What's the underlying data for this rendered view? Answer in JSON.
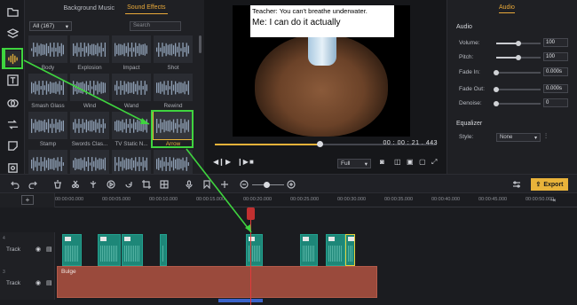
{
  "library": {
    "tabs": [
      {
        "label": "Background Music"
      },
      {
        "label": "Sound Effects"
      }
    ],
    "filter": "All (167)",
    "search_placeholder": "Search",
    "items": [
      "Body",
      "Explosion",
      "Impact",
      "Shot",
      "Smash Glass",
      "Wind",
      "Wand",
      "Rewind",
      "Stamp",
      "Swords Clas...",
      "TV Static N...",
      "Arrow",
      "",
      "",
      "",
      ""
    ],
    "selected": "Arrow"
  },
  "preview": {
    "caption_line1": "Teacher: You can't breathe underwater.",
    "caption_line2": "Me: I can do it actually",
    "timecode": "00 : 00 : 21 . 443",
    "progress": 0.47,
    "zoom_label": "Full"
  },
  "props": {
    "tab": "Audio",
    "section": "Audio",
    "rows": [
      {
        "label": "Volume:",
        "value": "100"
      },
      {
        "label": "Pitch:",
        "value": "100"
      },
      {
        "label": "Fade In:",
        "value": "0.000s"
      },
      {
        "label": "Fade Out:",
        "value": "0.000s"
      },
      {
        "label": "Denoise:",
        "value": "0"
      }
    ],
    "eq_section": "Equalizer",
    "eq_style_label": "Style:",
    "eq_style_value": "None"
  },
  "toolbar": {
    "export_label": "Export"
  },
  "timeline": {
    "ticks": [
      "00:00:00.000",
      "00:00:05.000",
      "00:00:10.000",
      "00:00:15.000",
      "00:00:20.000",
      "00:00:25.000",
      "00:00:30.000",
      "00:00:35.000",
      "00:00:40.000",
      "00:00:45.000",
      "00:00:50.000"
    ],
    "tracks": [
      {
        "num": "4",
        "name": "Track"
      },
      {
        "num": "3",
        "name": "Track"
      }
    ],
    "bulge_label": "Bulge"
  },
  "colors": {
    "accent": "#e9b33a",
    "highlight": "#3fd43f",
    "audio_clip": "#1d8778",
    "effect_clip": "#9a4a3c",
    "playhead": "#e23a3a"
  }
}
